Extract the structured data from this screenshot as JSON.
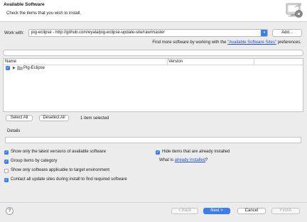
{
  "header": {
    "title": "Available Software",
    "subtitle": "Check the items that you wish to install."
  },
  "work_with": {
    "label": "Work with:",
    "value": "pig-eclipse - http://github.com/eyala/pig-eclipse-update-site/raw/master",
    "add_label": "Add..."
  },
  "more": {
    "prefix": "Find more software by working with the ",
    "link": "\"Available Software Sites\"",
    "suffix": " preferences."
  },
  "tree": {
    "columns": [
      "Name",
      "Version"
    ],
    "rows": [
      {
        "label": "Pig-Eclipse",
        "checked": true
      }
    ]
  },
  "selection": {
    "select_all": "Select All",
    "deselect_all": "Deselect All",
    "status": "1 item selected"
  },
  "details": {
    "title": "Details"
  },
  "options": {
    "latest_versions": "Show only the latest versions of available software",
    "hide_installed": "Hide items that are already installed",
    "group_by_category": "Group items by category",
    "what_is_prefix": "What is ",
    "what_is_link": "already installed",
    "what_is_suffix": "?",
    "target_env": "Show only software applicable to target environment",
    "contact_sites": "Contact all update sites during install to find required software"
  },
  "footer": {
    "help": "?",
    "back": "< Back",
    "next": "Next >",
    "cancel": "Cancel",
    "finish": "Finish"
  },
  "colors": {
    "accent": "#3b7ded",
    "link": "#1f4fd6"
  }
}
